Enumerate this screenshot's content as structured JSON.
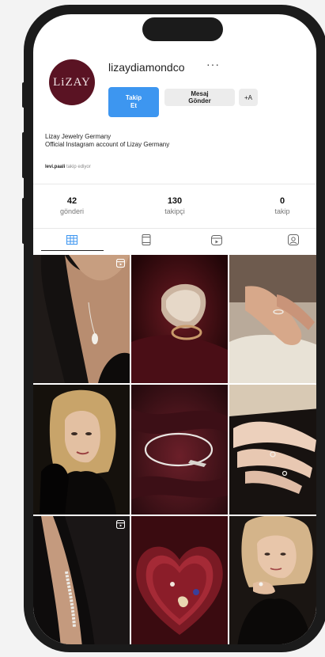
{
  "profile": {
    "username": "lizaydiamondco",
    "avatar_text": "LiZAY",
    "more_icon": "more-icon"
  },
  "actions": {
    "follow_label": "Takip Et",
    "message_label": "Mesaj Gönder",
    "add_user_label": "+A"
  },
  "bio": {
    "line1": "Lizay Jewelry Germany",
    "line2": "Official Instagram account of Lizay Germany",
    "followed_by_name": "levi.paali",
    "followed_by_rest": "takip ediyor"
  },
  "stats": [
    {
      "value": "42",
      "label": "gönderi"
    },
    {
      "value": "130",
      "label": "takipçi"
    },
    {
      "value": "0",
      "label": "takip"
    }
  ],
  "tabs": [
    {
      "icon": "grid-icon",
      "active": true
    },
    {
      "icon": "reels-icon",
      "active": false
    },
    {
      "icon": "collab-icon",
      "active": false
    },
    {
      "icon": "tagged-icon",
      "active": false
    }
  ],
  "colors": {
    "follow_button": "#3d96f0",
    "avatar_bg": "#5a1323",
    "phone_frame": "#1b1b1b"
  },
  "posts": [
    {
      "subject": "woman wearing drop pendant necklace",
      "reel": true
    },
    {
      "subject": "diamond pavé ring on dark red",
      "reel": false
    },
    {
      "subject": "hand with ring on stone",
      "reel": false
    },
    {
      "subject": "blonde woman in black gloves",
      "reel": false
    },
    {
      "subject": "diamond bracelet on red velvet",
      "reel": false
    },
    {
      "subject": "hands with rings",
      "reel": false
    },
    {
      "subject": "wrist with tennis bracelet",
      "reel": true
    },
    {
      "subject": "heart box with jewelry",
      "reel": false
    },
    {
      "subject": "blonde woman with rings",
      "reel": false
    }
  ]
}
